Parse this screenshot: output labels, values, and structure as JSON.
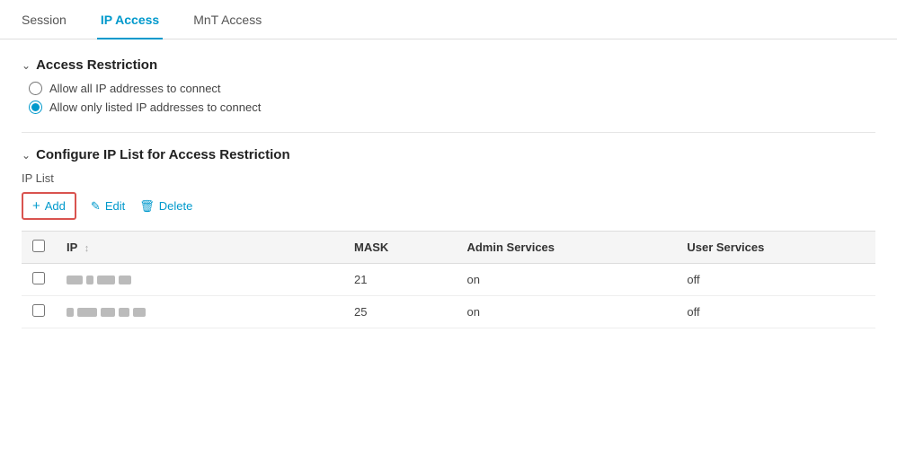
{
  "tabs": {
    "items": [
      {
        "id": "session",
        "label": "Session",
        "active": false
      },
      {
        "id": "ip-access",
        "label": "IP Access",
        "active": true
      },
      {
        "id": "mnt-access",
        "label": "MnT Access",
        "active": false
      }
    ]
  },
  "access_restriction": {
    "section_title": "Access Restriction",
    "options": [
      {
        "id": "allow-all",
        "label": "Allow all IP addresses to connect",
        "checked": false
      },
      {
        "id": "allow-listed",
        "label": "Allow only listed IP addresses to connect",
        "checked": true
      }
    ]
  },
  "ip_list_section": {
    "section_title": "Configure IP List for Access Restriction",
    "ip_list_label": "IP List",
    "toolbar": {
      "add_label": "Add",
      "edit_label": "Edit",
      "delete_label": "Delete"
    },
    "table": {
      "columns": [
        {
          "id": "checkbox",
          "label": ""
        },
        {
          "id": "ip",
          "label": "IP",
          "sortable": true
        },
        {
          "id": "mask",
          "label": "MASK"
        },
        {
          "id": "admin-services",
          "label": "Admin Services"
        },
        {
          "id": "user-services",
          "label": "User Services"
        }
      ],
      "rows": [
        {
          "id": 1,
          "mask": "21",
          "admin_services": "on",
          "user_services": "off"
        },
        {
          "id": 2,
          "mask": "25",
          "admin_services": "on",
          "user_services": "off"
        }
      ]
    }
  }
}
